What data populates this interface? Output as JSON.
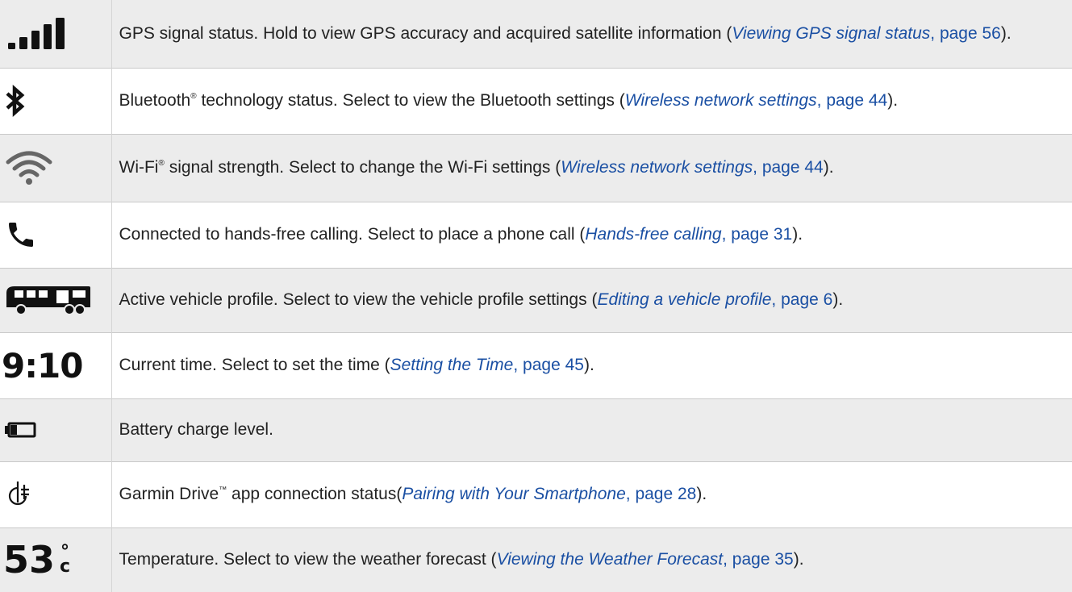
{
  "rows": [
    {
      "icon": "gps-signal-icon",
      "text": "GPS signal status. Hold to view GPS accuracy and acquired satellite information (",
      "link_title": "Viewing GPS signal status",
      "link_page": "page 56",
      "tail": ")."
    },
    {
      "icon": "bluetooth-icon",
      "text_a": "Bluetooth",
      "sup": "®",
      "text_b": " technology status. Select to view the Bluetooth settings (",
      "link_title": "Wireless network settings",
      "link_page": "page 44",
      "tail": ")."
    },
    {
      "icon": "wifi-icon",
      "text_a": "Wi-Fi",
      "sup": "®",
      "text_b": " signal strength. Select to change the Wi-Fi settings (",
      "link_title": "Wireless network settings",
      "link_page": "page 44",
      "tail": ")."
    },
    {
      "icon": "phone-icon",
      "text": "Connected to hands-free calling. Select to place a phone call (",
      "link_title": "Hands-free calling",
      "link_page": "page 31",
      "tail": ")."
    },
    {
      "icon": "rv-vehicle-icon",
      "text": "Active vehicle profile. Select to view the vehicle profile settings (",
      "link_title": "Editing a vehicle profile",
      "link_page": "page 6",
      "tail": ")."
    },
    {
      "icon_text": "9:10",
      "text": "Current time. Select to set the time (",
      "link_title": "Setting the Time",
      "link_page": "page 45",
      "tail": ")."
    },
    {
      "icon": "battery-icon",
      "text": "Battery charge level."
    },
    {
      "icon": "garmin-drive-icon",
      "text_a": "Garmin Drive",
      "sup": "™",
      "text_b": " app connection status(",
      "link_title": "Pairing with Your Smartphone",
      "link_page": "page 28",
      "tail": ")."
    },
    {
      "icon_text": "53",
      "icon_unit_deg": "°",
      "icon_unit_c": "c",
      "text": "Temperature. Select to view the weather forecast (",
      "link_title": "Viewing the Weather Forecast",
      "link_page": "page 35",
      "tail": ")."
    }
  ],
  "sep": ", "
}
